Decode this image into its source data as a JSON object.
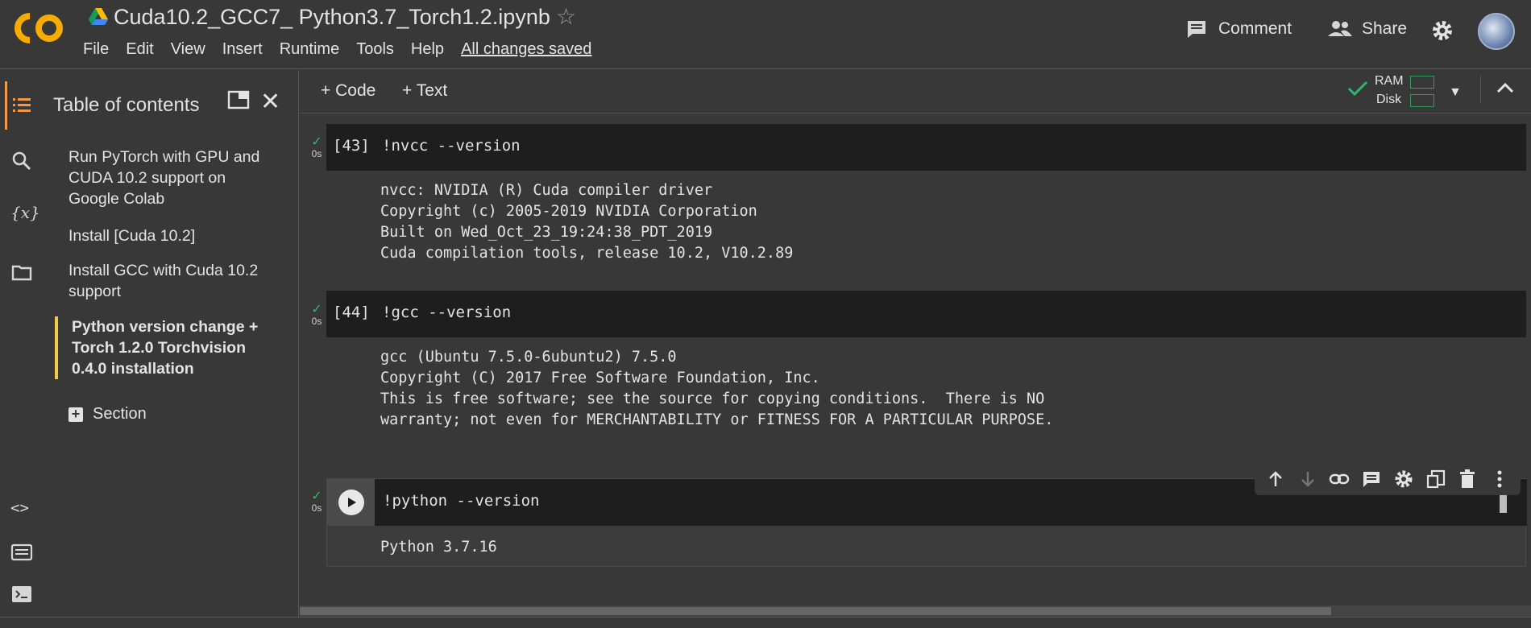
{
  "app": {
    "logo_text": "CO",
    "title": "Cuda10.2_GCC7_ Python3.7_Torch1.2.ipynb",
    "menu": [
      "File",
      "Edit",
      "View",
      "Insert",
      "Runtime",
      "Tools",
      "Help"
    ],
    "saved_status": "All changes saved",
    "comment_label": "Comment",
    "share_label": "Share"
  },
  "sidebar": {
    "title": "Table of contents",
    "items": [
      {
        "label": "Run PyTorch with GPU and CUDA 10.2 support on Google Colab"
      },
      {
        "label": "Install [Cuda 10.2]"
      },
      {
        "label": "Install GCC with Cuda 10.2 support"
      },
      {
        "label": "Python version change + Torch 1.2.0 Torchvision 0.4.0 installation",
        "active": true
      }
    ],
    "section_label": "Section"
  },
  "toolbar": {
    "add_code": "+ Code",
    "add_text": "+ Text",
    "ram_label": "RAM",
    "disk_label": "Disk"
  },
  "cells": [
    {
      "status": "0s",
      "exec_count": "[43]",
      "code": "!nvcc --version",
      "output": "nvcc: NVIDIA (R) Cuda compiler driver\nCopyright (c) 2005-2019 NVIDIA Corporation\nBuilt on Wed_Oct_23_19:24:38_PDT_2019\nCuda compilation tools, release 10.2, V10.2.89"
    },
    {
      "status": "0s",
      "exec_count": "[44]",
      "code": "!gcc --version",
      "output": "gcc (Ubuntu 7.5.0-6ubuntu2) 7.5.0\nCopyright (C) 2017 Free Software Foundation, Inc.\nThis is free software; see the source for copying conditions.  There is NO\nwarranty; not even for MERCHANTABILITY or FITNESS FOR A PARTICULAR PURPOSE."
    },
    {
      "status": "0s",
      "code": "!python --version",
      "output": "Python 3.7.16"
    }
  ],
  "colors": {
    "accent_orange": "#f2994a",
    "active_toc_border": "#f4c84b",
    "success_green": "#2eb872"
  }
}
